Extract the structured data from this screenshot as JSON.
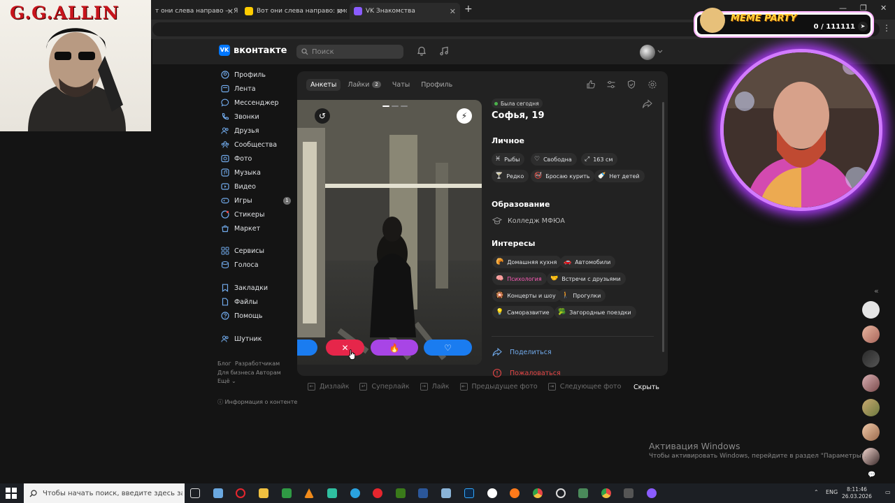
{
  "browser": {
    "tabs": [
      {
        "title": "т они слева направо — Янд",
        "active": false
      },
      {
        "title": "Вот они слева направо: смотр",
        "active": false
      },
      {
        "title": "VK Знакомства",
        "active": true
      }
    ]
  },
  "overlays": {
    "left_title": "G.G.ALLIN",
    "meme_party": {
      "title": "MEME PARTY",
      "counter": "0 / 111111"
    }
  },
  "header": {
    "logo_text": "вконтакте",
    "search_placeholder": "Поиск"
  },
  "nav": {
    "items": [
      {
        "label": "Профиль",
        "icon": "user-icon"
      },
      {
        "label": "Лента",
        "icon": "news-icon"
      },
      {
        "label": "Мессенджер",
        "icon": "message-icon"
      },
      {
        "label": "Звонки",
        "icon": "phone-icon"
      },
      {
        "label": "Друзья",
        "icon": "friends-icon"
      },
      {
        "label": "Сообщества",
        "icon": "groups-icon"
      },
      {
        "label": "Фото",
        "icon": "photo-icon"
      },
      {
        "label": "Музыка",
        "icon": "music-icon"
      },
      {
        "label": "Видео",
        "icon": "video-icon"
      },
      {
        "label": "Игры",
        "icon": "games-icon",
        "badge": "1"
      },
      {
        "label": "Стикеры",
        "icon": "stickers-icon"
      },
      {
        "label": "Маркет",
        "icon": "market-icon"
      },
      {
        "label": "Сервисы",
        "icon": "services-icon"
      },
      {
        "label": "Голоса",
        "icon": "votes-icon"
      },
      {
        "label": "Закладки",
        "icon": "bookmark-icon"
      },
      {
        "label": "Файлы",
        "icon": "files-icon"
      },
      {
        "label": "Помощь",
        "icon": "help-icon"
      },
      {
        "label": "Шутник",
        "icon": "joker-icon"
      }
    ],
    "footer": {
      "blog": "Блог",
      "developers": "Разработчикам",
      "business": "Для бизнеса",
      "authors": "Авторам",
      "more": "Ещё",
      "content_info": "Информация о контенте"
    }
  },
  "dating": {
    "tabs": [
      {
        "label": "Анкеты",
        "active": true
      },
      {
        "label": "Лайки",
        "badge": "2"
      },
      {
        "label": "Чаты"
      },
      {
        "label": "Профиль"
      }
    ],
    "profile": {
      "status": "Была сегодня",
      "name": "Софья, 19",
      "personal_title": "Личное",
      "personal_chips": [
        {
          "icon": "♓",
          "label": "Рыбы"
        },
        {
          "icon": "♡",
          "label": "Свободна"
        },
        {
          "icon": "⤢",
          "label": "163 см"
        },
        {
          "icon": "🍸",
          "label": "Редко"
        },
        {
          "icon": "🚭",
          "label": "Бросаю курить"
        },
        {
          "icon": "🍼",
          "label": "Нет детей"
        }
      ],
      "education_title": "Образование",
      "education": "Колледж МФЮА",
      "interests_title": "Интересы",
      "interests": [
        {
          "icon": "🥐",
          "label": "Домашняя кухня"
        },
        {
          "icon": "🚗",
          "label": "Автомобили"
        },
        {
          "icon": "🧠",
          "label": "Психология",
          "highlight": true
        },
        {
          "icon": "🤝",
          "label": "Встречи с друзьями"
        },
        {
          "icon": "🎇",
          "label": "Концерты и шоу"
        },
        {
          "icon": "🚶",
          "label": "Прогулки"
        },
        {
          "icon": "💡",
          "label": "Саморазвитие"
        },
        {
          "icon": "🥦",
          "label": "Загородные поездки"
        }
      ],
      "share": "Поделиться",
      "report": "Пожаловаться"
    },
    "hints": [
      {
        "key": "←",
        "label": "Дизлайк"
      },
      {
        "key": "↵",
        "label": "Суперлайк"
      },
      {
        "key": "→",
        "label": "Лайк"
      },
      {
        "key": "⇤",
        "label": "Предыдущее фото"
      },
      {
        "key": "⇥",
        "label": "Следующее фото"
      }
    ],
    "hide": "Скрыть"
  },
  "windows_activation": {
    "title": "Активация Windows",
    "text": "Чтобы активировать Windows, перейдите в раздел \"Параметры\"."
  },
  "taskbar": {
    "search_placeholder": "Чтобы начать поиск, введите здесь запрос",
    "lang": "ENG",
    "time": "8:11:46",
    "date": "26.03.2026"
  },
  "colors": {
    "vk_blue": "#0077ff",
    "dislike_red": "#e6264a",
    "superlike_purple": "#a845e6",
    "like_blue": "#1a7cf0",
    "background": "#141414",
    "card": "#222222"
  }
}
